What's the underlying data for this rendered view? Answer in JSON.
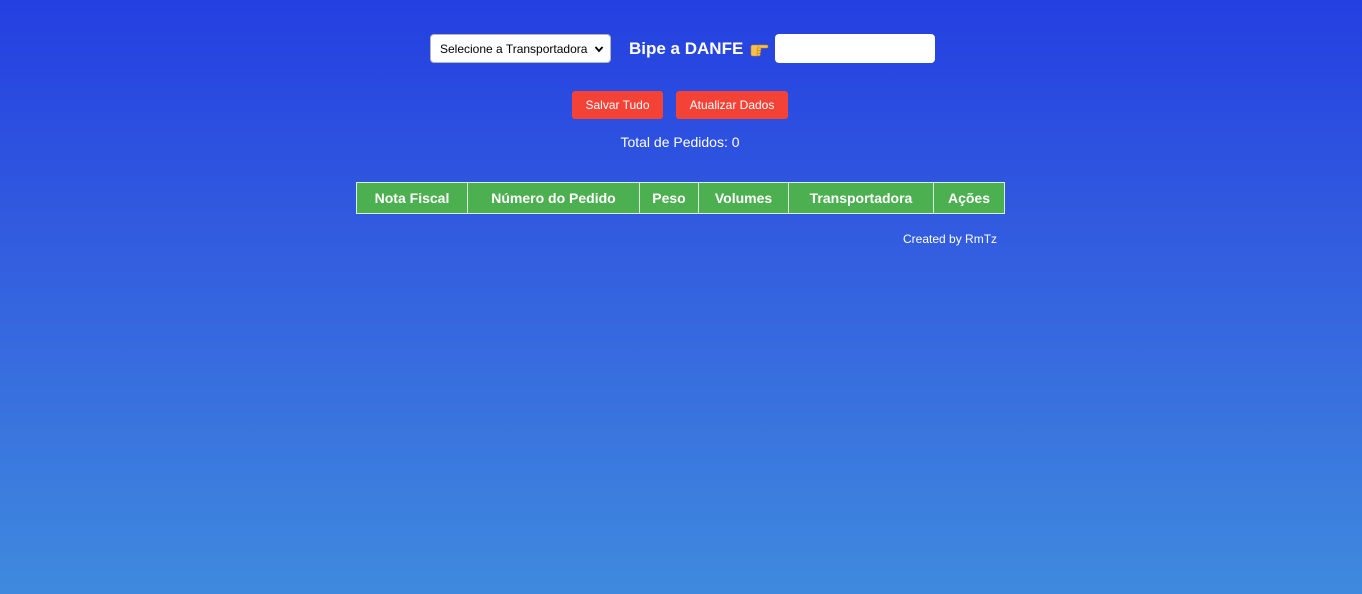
{
  "toolbar": {
    "carrier_select": {
      "selected": "Selecione a Transportadora",
      "icon": "chevron-down-icon"
    },
    "scan_label": "Bipe a DANFE",
    "scan_icon": "pointing-hand-icon",
    "scan_input_value": "",
    "scan_input_placeholder": ""
  },
  "actions": {
    "save_all": "Salvar Tudo",
    "refresh": "Atualizar Dados"
  },
  "summary": {
    "total_label": "Total de Pedidos:",
    "total_value": "0"
  },
  "table": {
    "columns": [
      "Nota Fiscal",
      "Número do Pedido",
      "Peso",
      "Volumes",
      "Transportadora",
      "Ações"
    ],
    "rows": []
  },
  "footer": {
    "credit": "Created by RmTz"
  },
  "colors": {
    "background_top": "#243fe0",
    "background_bottom": "#3f8ade",
    "button": "#f44336",
    "table_header": "#4caf50"
  }
}
